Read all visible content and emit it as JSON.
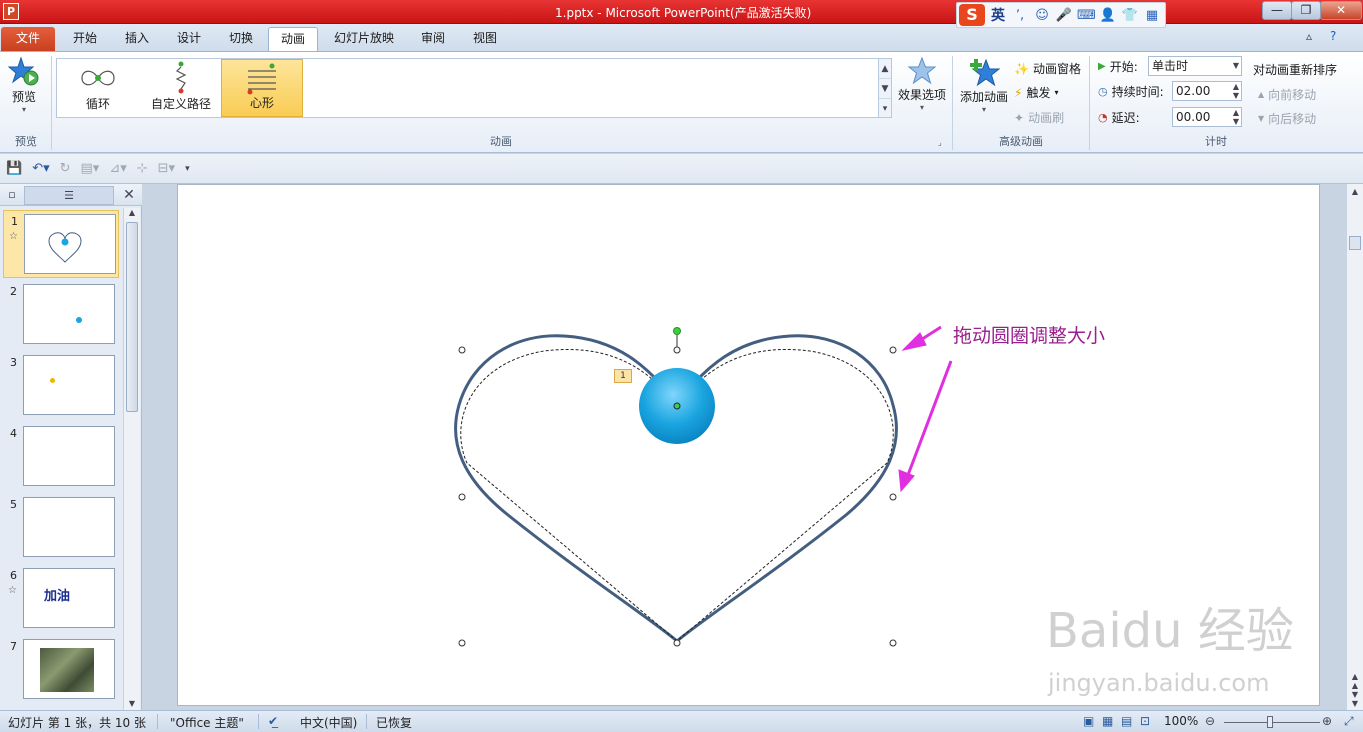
{
  "titlebar": {
    "title": "1.pptx - Microsoft PowerPoint(产品激活失败)",
    "app_icon": "P",
    "minimize": "—",
    "restore": "❐",
    "close": "✕"
  },
  "ime": {
    "logo": "S",
    "lang": "英"
  },
  "tabs": [
    {
      "label": "文件"
    },
    {
      "label": "开始"
    },
    {
      "label": "插入"
    },
    {
      "label": "设计"
    },
    {
      "label": "切换"
    },
    {
      "label": "动画"
    },
    {
      "label": "幻灯片放映"
    },
    {
      "label": "审阅"
    },
    {
      "label": "视图"
    }
  ],
  "ribbon": {
    "preview": {
      "label": "预览",
      "group": "预览"
    },
    "animation_gallery": {
      "group": "动画",
      "items": [
        {
          "label": "循环"
        },
        {
          "label": "自定义路径"
        },
        {
          "label": "心形"
        }
      ],
      "effect_options": "效果选项"
    },
    "advanced": {
      "group": "高级动画",
      "add_animation": "添加动画",
      "animation_pane": "动画窗格",
      "trigger": "触发",
      "animation_painter": "动画刷"
    },
    "timing": {
      "group": "计时",
      "start_label": "开始:",
      "start_value": "单击时",
      "duration_label": "持续时间:",
      "duration_value": "02.00",
      "delay_label": "延迟:",
      "delay_value": "00.00",
      "reorder_title": "对动画重新排序",
      "move_earlier": "向前移动",
      "move_later": "向后移动"
    }
  },
  "slides": [
    {
      "num": "1",
      "star": "☆"
    },
    {
      "num": "2"
    },
    {
      "num": "3"
    },
    {
      "num": "4"
    },
    {
      "num": "5"
    },
    {
      "num": "6",
      "star": "☆",
      "text": "加油"
    },
    {
      "num": "7"
    }
  ],
  "canvas": {
    "annotation": "拖动圆圈调整大小",
    "anim_tag": "1",
    "watermark": "Baidu 经验",
    "watermark_url": "jingyan.baidu.com"
  },
  "status": {
    "slide_info": "幻灯片 第 1 张，共 10 张",
    "theme": "\"Office 主题\"",
    "language": "中文(中国)",
    "recovered": "已恢复",
    "zoom": "100%"
  },
  "colors": {
    "heart_stroke": "#435e80",
    "ball": "#1aa5e0",
    "arrow": "#e02ee0",
    "annotation": "#9a1f8f"
  }
}
